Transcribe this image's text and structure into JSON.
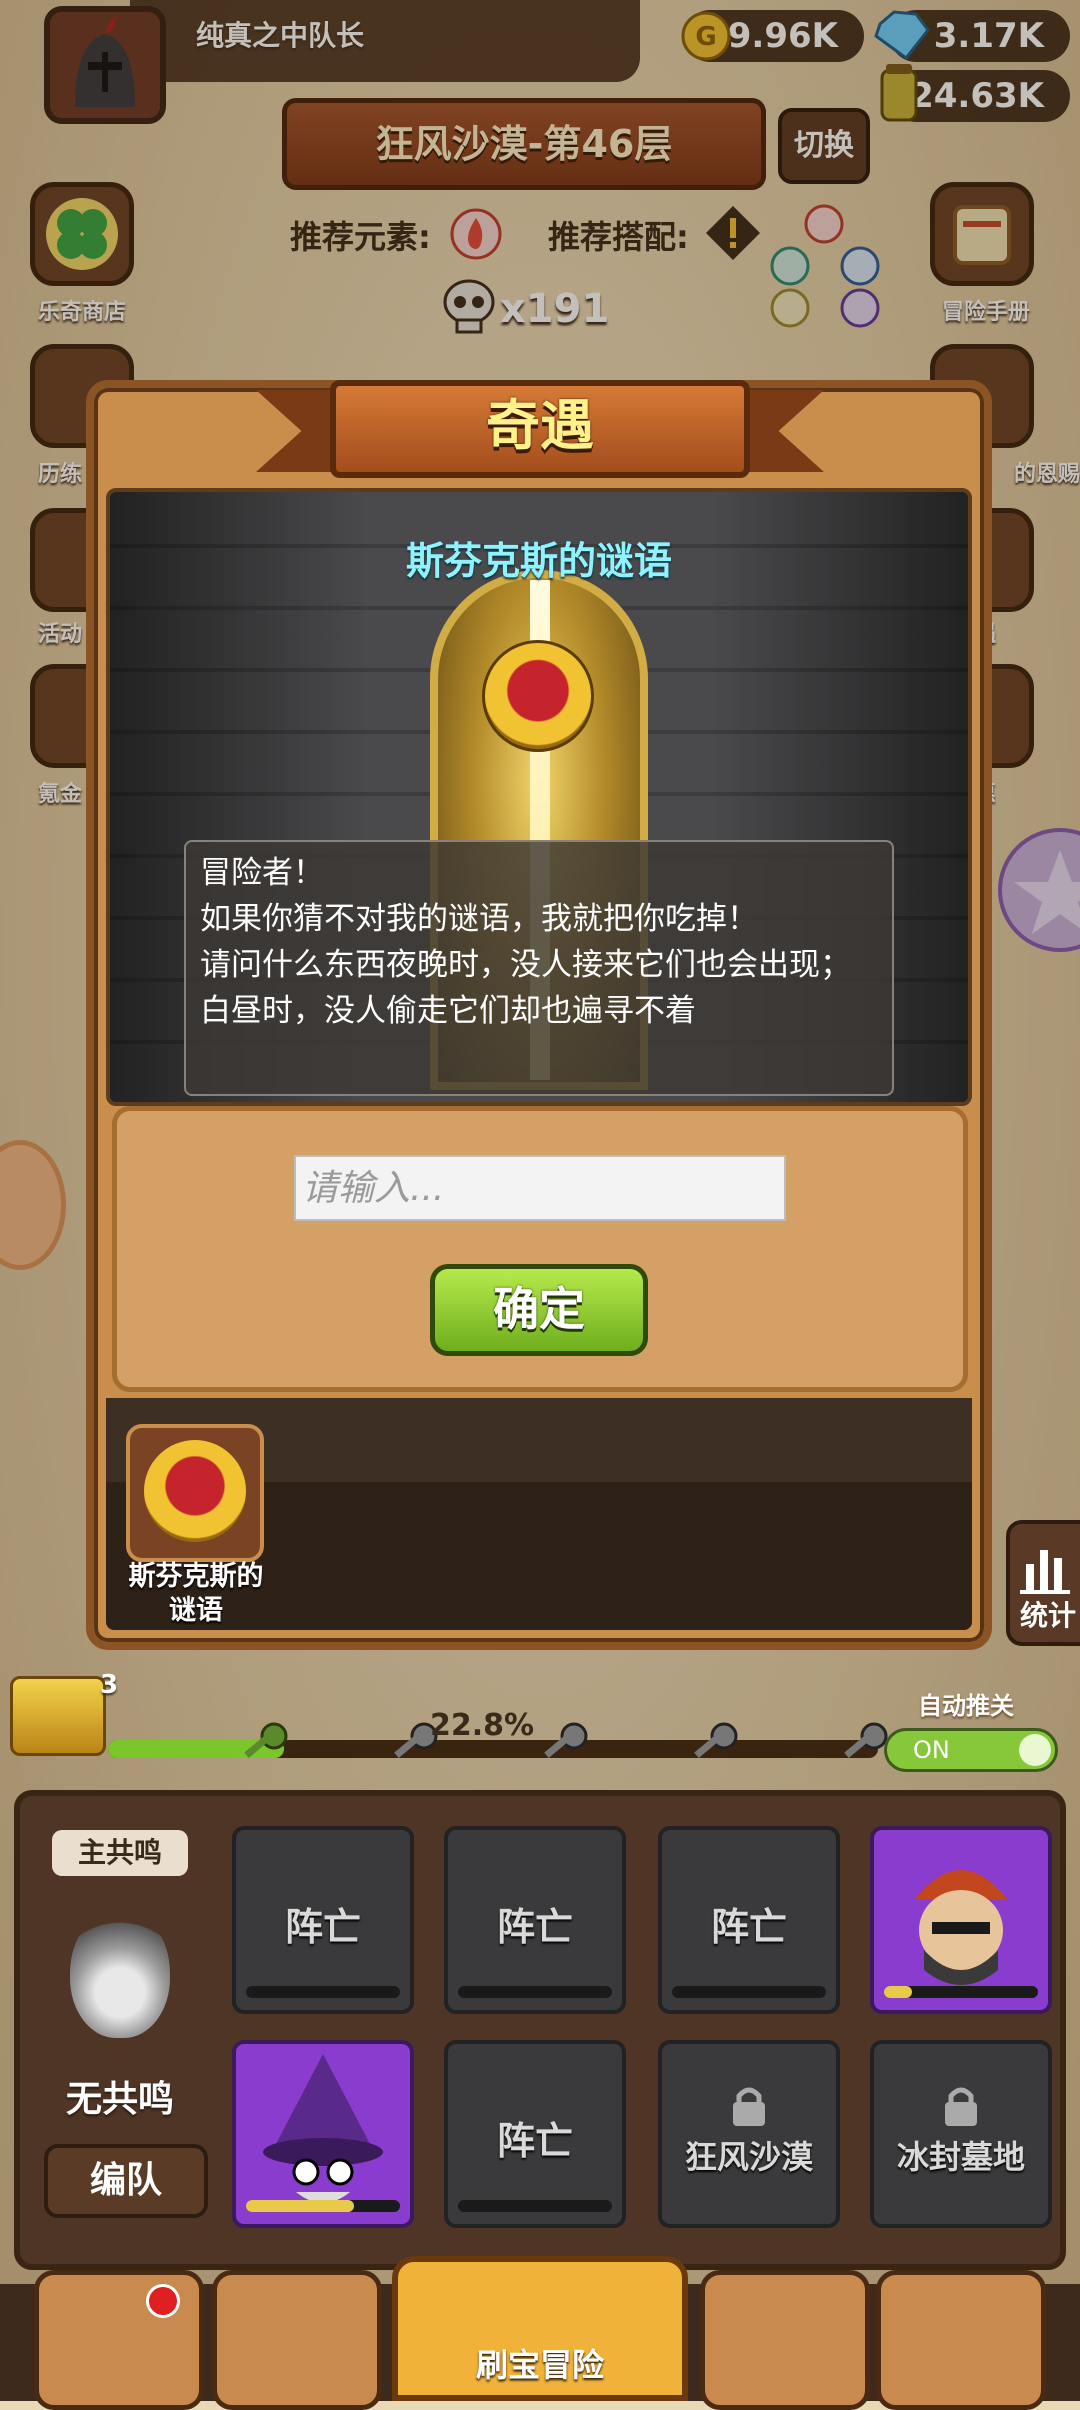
{
  "player": {
    "name": "纯真之中队长"
  },
  "resources": {
    "gold": "49.96K",
    "gems": "3.17K",
    "potion": "24.63K"
  },
  "stage": {
    "title": "狂风沙漠-第46层",
    "switch_label": "切换"
  },
  "recommend": {
    "element_label": "推荐元素:",
    "combo_label": "推荐搭配:",
    "skull_count": "x191"
  },
  "side_left": [
    {
      "label": "乐奇商店",
      "icon": "clover-icon"
    },
    {
      "label": "历练",
      "icon": "jar-icon"
    },
    {
      "label": "活动",
      "icon": "gift-icon"
    },
    {
      "label": "氪金",
      "icon": "diamond-icon"
    }
  ],
  "side_right": [
    {
      "label": "冒险手册",
      "icon": "scroll-icon"
    },
    {
      "label": "的恩赐",
      "icon": "chest-icon"
    },
    {
      "label": "遇",
      "icon": "quest-icon"
    },
    {
      "label": "惠",
      "icon": "gift-box-icon"
    }
  ],
  "modal": {
    "title": "奇遇",
    "riddle_title": "斯芬克斯的谜语",
    "dialog_lines": [
      "冒险者！",
      "如果你猜不对我的谜语，我就把你吃掉！",
      "请问什么东西夜晚时，没人接来它们也会出现；",
      "白昼时，没人偷走它们却也遍寻不着"
    ],
    "input_placeholder": "请输入...",
    "confirm_label": "确定",
    "event_label_line1": "斯芬克斯的",
    "event_label_line2": "谜语"
  },
  "stats": {
    "label": "统计"
  },
  "progress": {
    "percent_text": "22.8%",
    "value": 0.228,
    "chest_count": "3",
    "auto_label": "自动推关",
    "toggle_label": "ON"
  },
  "team": {
    "resonance_tag": "主共鸣",
    "no_resonance": "无共鸣",
    "formation_label": "编队",
    "row1": [
      {
        "label": "阵亡",
        "stars": 3,
        "element": "fire"
      },
      {
        "label": "阵亡",
        "stars": 1,
        "element": "wind"
      },
      {
        "label": "阵亡",
        "stars": 3,
        "element": "light"
      },
      {
        "label": "",
        "stars": 3,
        "element": "fire",
        "hp": 0.18
      }
    ],
    "row2": [
      {
        "label": "",
        "stars": 3,
        "element": "dark",
        "hp": 0.7
      },
      {
        "label": "阵亡",
        "stars": 1,
        "element": "water"
      },
      {
        "label": "狂风沙漠",
        "locked": true
      },
      {
        "label": "冰封墓地",
        "locked": true
      }
    ]
  },
  "nav": {
    "active_label": "刷宝冒险"
  },
  "colors": {
    "accent": "#c98e4b",
    "confirm_green": "#7bc62a",
    "title_yellow": "#fff28a",
    "riddle_cyan": "#8ff3ff"
  }
}
